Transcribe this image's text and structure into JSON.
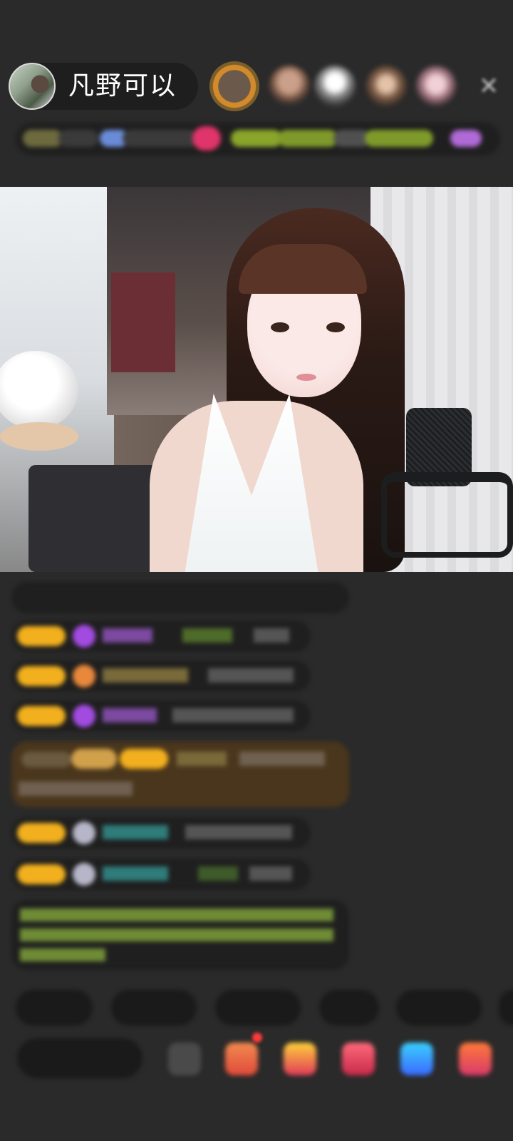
{
  "header": {
    "host_name": "凡野可以",
    "close_icon": "close-icon"
  },
  "colors": {
    "background": "#2a2a2a",
    "badge_gold": "#f2b01e",
    "chat_green": "#9fc84a",
    "chat_cyan": "#33b6b0",
    "chat_purple": "#a05ad0",
    "highlight_brown": "#5a3a1a"
  },
  "icons": {
    "close": "close-icon",
    "gift": "gift-icon",
    "share": "share-icon",
    "red_packet": "red-packet-icon"
  }
}
